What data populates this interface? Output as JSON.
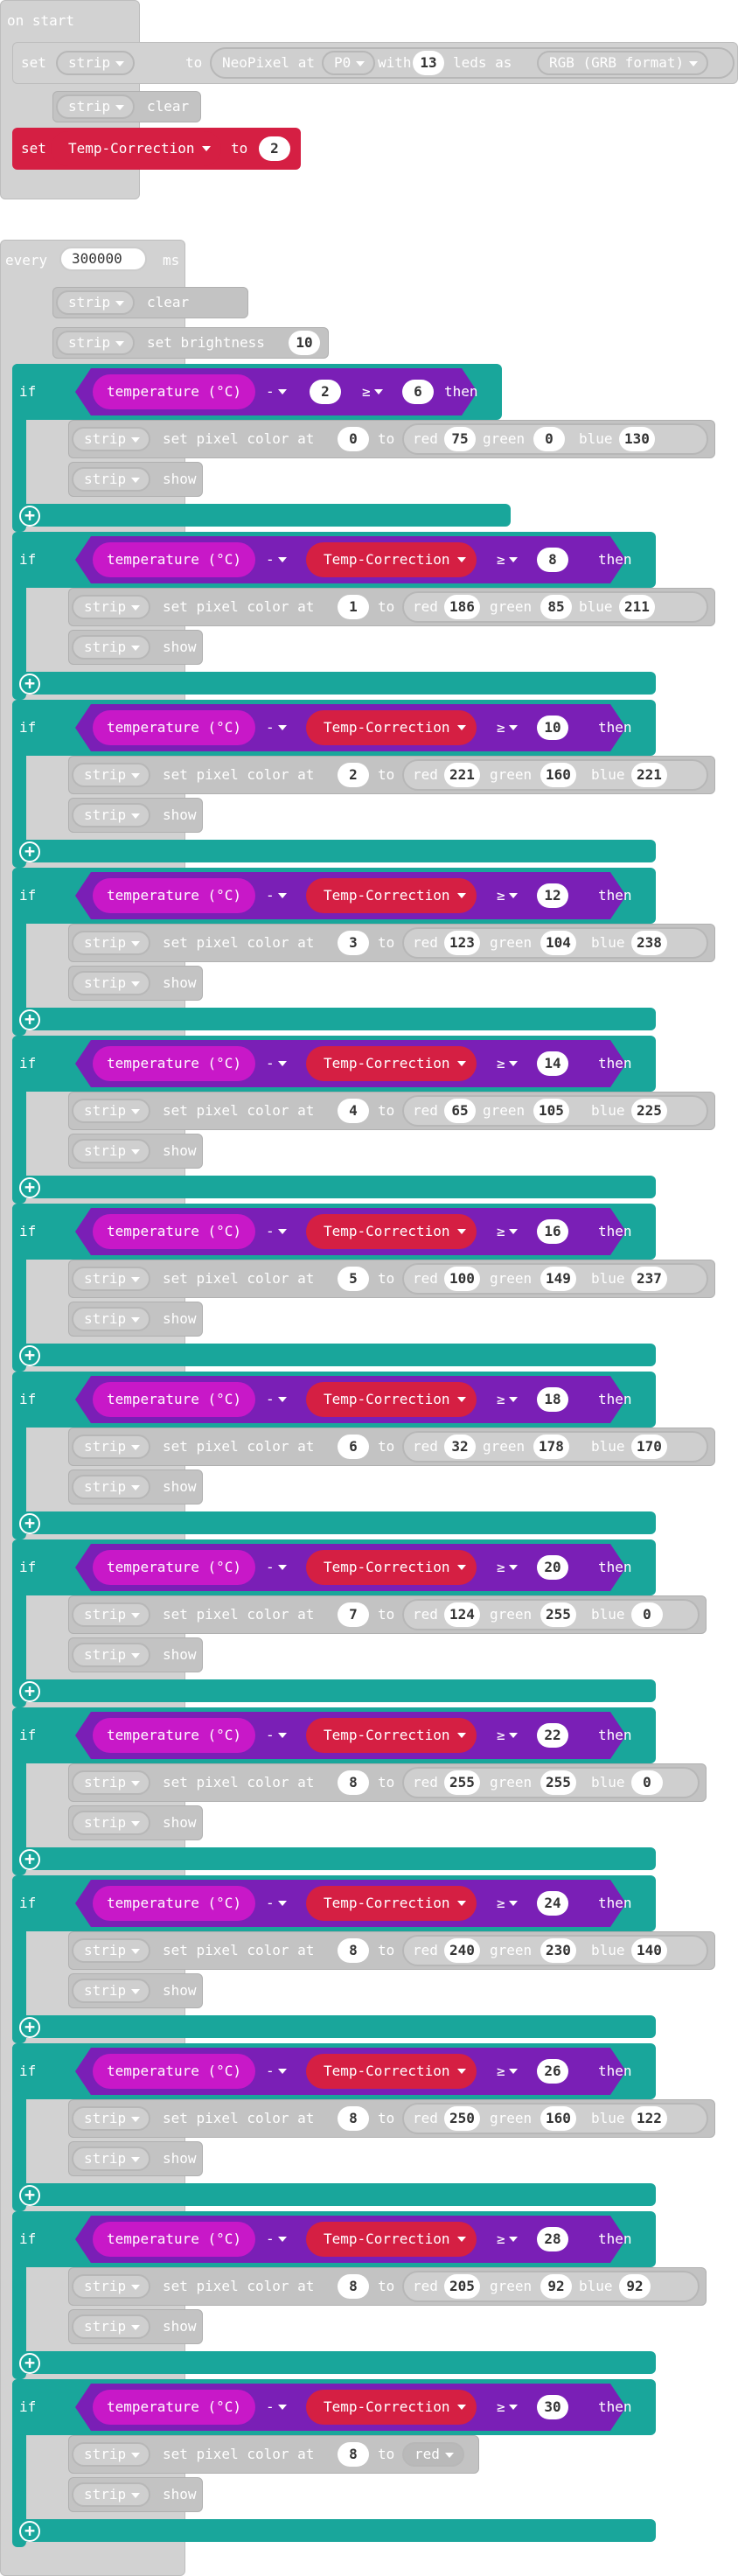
{
  "on_start": {
    "hat_label": "on start",
    "set_kw": "set",
    "strip_var": "strip",
    "to_kw": "to",
    "neopixel_at_pin": "NeoPixel at pin",
    "pin": "P0",
    "with_kw": "with",
    "led_count": "13",
    "leds_as": "leds as",
    "format": "RGB (GRB format)",
    "clear_label": "clear",
    "set_tc_var": "Temp-Correction",
    "set_tc_value": "2"
  },
  "every_block": {
    "every_kw": "every",
    "interval": "300000",
    "unit": "ms",
    "clear_label": "clear",
    "set_brightness_label": "set brightness",
    "brightness": "10"
  },
  "labels": {
    "if": "if",
    "then": "then",
    "temperature": "temperature (°C)",
    "minus": "-",
    "gte": "≥",
    "strip": "strip",
    "set_pixel_color_at": "set pixel color at",
    "to": "to",
    "red": "red",
    "green": "green",
    "blue": "blue",
    "show": "show",
    "temp_correction": "Temp-Correction",
    "add_icon": "+"
  },
  "conditions": [
    {
      "subtrahend": "2",
      "threshold": "6",
      "pixel": "0",
      "red": "75",
      "green": "0",
      "blue": "130"
    },
    {
      "subtrahend": "Temp-Correction",
      "threshold": "8",
      "pixel": "1",
      "red": "186",
      "green": "85",
      "blue": "211"
    },
    {
      "subtrahend": "Temp-Correction",
      "threshold": "10",
      "pixel": "2",
      "red": "221",
      "green": "160",
      "blue": "221"
    },
    {
      "subtrahend": "Temp-Correction",
      "threshold": "12",
      "pixel": "3",
      "red": "123",
      "green": "104",
      "blue": "238"
    },
    {
      "subtrahend": "Temp-Correction",
      "threshold": "14",
      "pixel": "4",
      "red": "65",
      "green": "105",
      "blue": "225"
    },
    {
      "subtrahend": "Temp-Correction",
      "threshold": "16",
      "pixel": "5",
      "red": "100",
      "green": "149",
      "blue": "237"
    },
    {
      "subtrahend": "Temp-Correction",
      "threshold": "18",
      "pixel": "6",
      "red": "32",
      "green": "178",
      "blue": "170"
    },
    {
      "subtrahend": "Temp-Correction",
      "threshold": "20",
      "pixel": "7",
      "red": "124",
      "green": "255",
      "blue": "0"
    },
    {
      "subtrahend": "Temp-Correction",
      "threshold": "22",
      "pixel": "8",
      "red": "255",
      "green": "255",
      "blue": "0"
    },
    {
      "subtrahend": "Temp-Correction",
      "threshold": "24",
      "pixel": "8",
      "red": "240",
      "green": "230",
      "blue": "140"
    },
    {
      "subtrahend": "Temp-Correction",
      "threshold": "26",
      "pixel": "8",
      "red": "250",
      "green": "160",
      "blue": "122"
    },
    {
      "subtrahend": "Temp-Correction",
      "threshold": "28",
      "pixel": "8",
      "red": "205",
      "green": "92",
      "blue": "92"
    },
    {
      "subtrahend": "Temp-Correction",
      "threshold": "30",
      "pixel": "8",
      "color_name": "red"
    }
  ],
  "colors": {
    "neopixel_grey": "#d2d2d2",
    "logic_teal": "#19a69b",
    "variable_red": "#d51f43",
    "math_purple": "#7a1fb6",
    "input_magenta": "#c818c8"
  }
}
